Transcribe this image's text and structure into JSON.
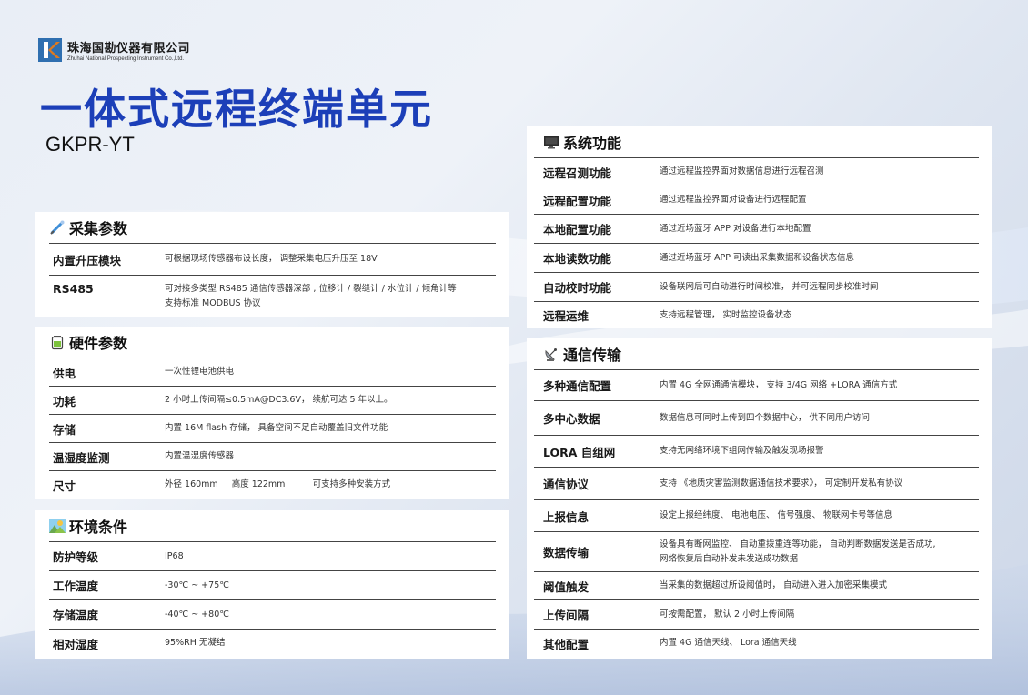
{
  "company": {
    "name_cn": "珠海国勘仪器有限公司",
    "name_en": "Zhuhai National Prospecting Instrument Co.,Ltd."
  },
  "title": "一体式远程终端单元",
  "model": "GKPR-YT",
  "colors": {
    "title_blue": "#1c3fb8",
    "logo_blue": "#2f6fb0",
    "logo_orange": "#e07a1f"
  },
  "acquisition": {
    "title": "采集参数",
    "icon": "sensor-probe-icon",
    "rows": [
      {
        "k": "内置升压模块",
        "v": "可根据现场传感器布设长度， 调整采集电压升压至 18V"
      },
      {
        "k": "RS485",
        "v": "可对接多类型 RS485 通信传感器深部 , 位移计 / 裂缝计 / 水位计 / 倾角计等",
        "v2": "支持标准 MODBUS 协议"
      }
    ]
  },
  "hardware": {
    "title": "硬件参数",
    "icon": "battery-icon",
    "rows": [
      {
        "k": "供电",
        "v": "一次性锂电池供电"
      },
      {
        "k": "功耗",
        "v": "2 小时上传间隔≤0.5mA@DC3.6V， 续航可达 5 年以上。"
      },
      {
        "k": "存储",
        "v": "内置 16M flash 存储， 具备空间不足自动覆盖旧文件功能"
      },
      {
        "k": "温湿度监测",
        "v": "内置温湿度传感器"
      },
      {
        "k": "尺寸",
        "v": "外径 160mm     高度 122mm          可支持多种安装方式"
      }
    ]
  },
  "environment": {
    "title": "环境条件",
    "icon": "landscape-icon",
    "rows": [
      {
        "k": "防护等级",
        "v": "IP68"
      },
      {
        "k": "工作温度",
        "v": "-30℃ ~ +75℃"
      },
      {
        "k": "存储温度",
        "v": "-40℃ ~ +80℃"
      },
      {
        "k": "相对湿度",
        "v": "95%RH 无凝结"
      }
    ]
  },
  "system": {
    "title": "系统功能",
    "icon": "monitor-icon",
    "rows": [
      {
        "k": "远程召测功能",
        "v": "通过远程监控界面对数据信息进行远程召测"
      },
      {
        "k": "远程配置功能",
        "v": "通过远程监控界面对设备进行远程配置"
      },
      {
        "k": "本地配置功能",
        "v": "通过近场蓝牙 APP 对设备进行本地配置"
      },
      {
        "k": "本地读数功能",
        "v": "通过近场蓝牙 APP 可读出采集数据和设备状态信息"
      },
      {
        "k": "自动校时功能",
        "v": "设备联网后可自动进行时间校准， 并可远程同步校准时间"
      },
      {
        "k": "远程运维",
        "v": "支持远程管理， 实时监控设备状态"
      }
    ]
  },
  "communication": {
    "title": "通信传输",
    "icon": "satellite-dish-icon",
    "rows": [
      {
        "k": "多种通信配置",
        "v": "内置 4G 全网通通信模块， 支持 3/4G 网络 +LORA 通信方式"
      },
      {
        "k": "多中心数据",
        "v": "数据信息可同时上传到四个数据中心， 供不同用户访问"
      },
      {
        "k": "LORA 自组网",
        "v": "支持无网络环境下组网传输及触发现场报警"
      },
      {
        "k": "通信协议",
        "v": "支持 《地质灾害监测数据通信技术要求》， 可定制开发私有协议"
      },
      {
        "k": "上报信息",
        "v": "设定上报经纬度、 电池电压、 信号强度、 物联网卡号等信息"
      },
      {
        "k": "数据传输",
        "v": "设备具有断网监控、 自动重拨重连等功能， 自动判断数据发送是否成功,",
        "v2": "网络恢复后自动补发未发送成功数据"
      },
      {
        "k": "阈值触发",
        "v": "当采集的数据超过所设阈值时， 自动进入进入加密采集模式"
      },
      {
        "k": "上传间隔",
        "v": "可按需配置， 默认 2 小时上传间隔"
      },
      {
        "k": "其他配置",
        "v": "内置 4G 通信天线、 Lora 通信天线"
      }
    ]
  }
}
